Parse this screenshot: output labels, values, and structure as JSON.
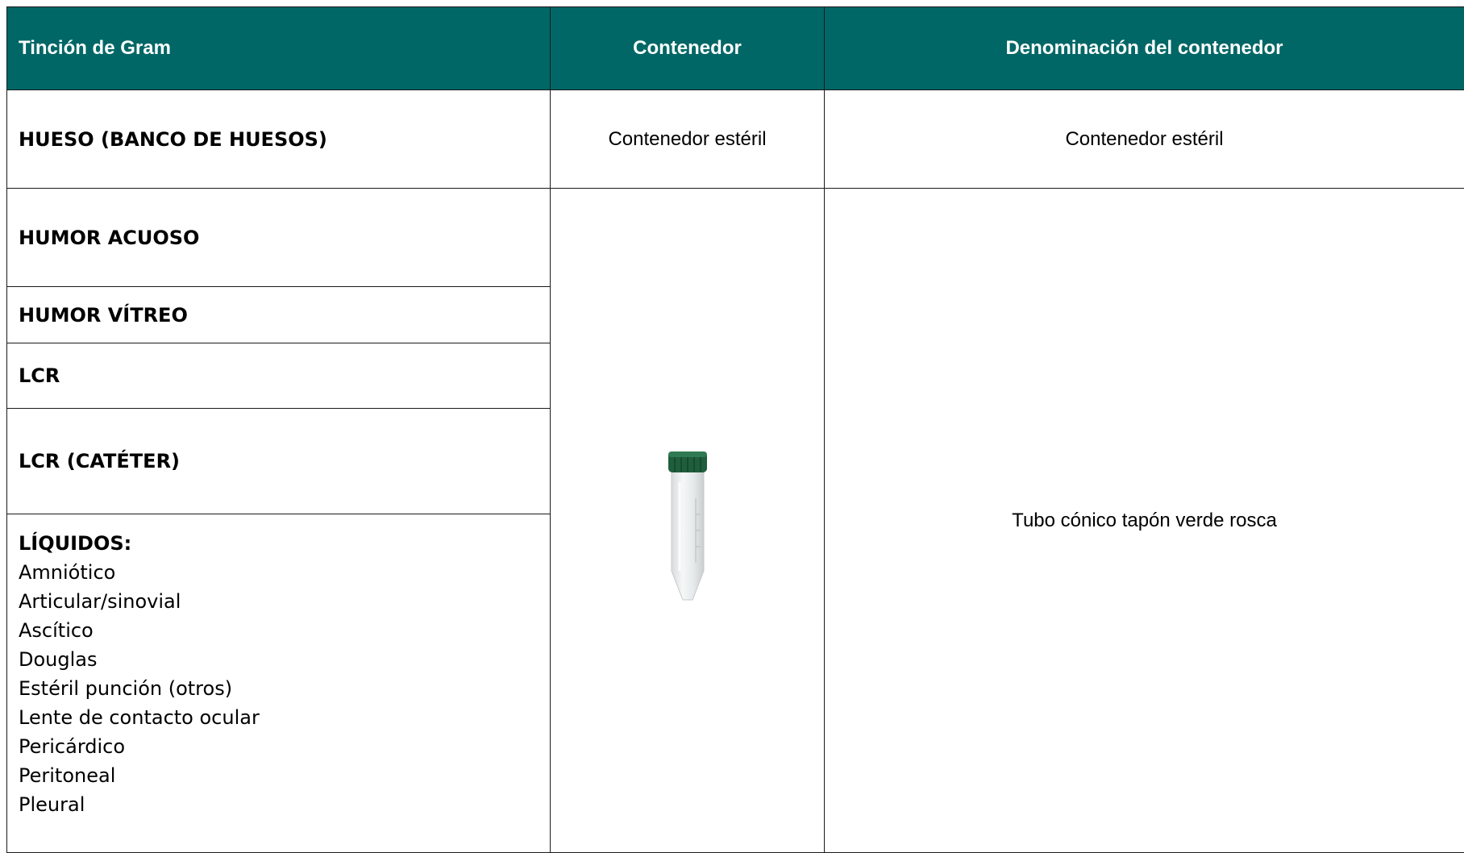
{
  "header": {
    "col1": "Tinción de Gram",
    "col2": "Contenedor",
    "col3": "Denominación del contenedor"
  },
  "rows": [
    {
      "sample": "HUESO (BANCO DE HUESOS)",
      "container": "Contenedor estéril",
      "container_name": "Contenedor estéril"
    }
  ],
  "group": {
    "samples": [
      "HUMOR ACUOSO",
      "HUMOR VÍTREO",
      "LCR",
      "LCR (CATÉTER)"
    ],
    "liquids": {
      "heading": "LÍQUIDOS:",
      "items": [
        "Amniótico",
        "Articular/sinovial",
        "Ascítico",
        "Douglas",
        "Estéril punción (otros)",
        "Lente de contacto ocular",
        "Pericárdico",
        "Peritoneal",
        "Pleural"
      ]
    },
    "container_icon": "conical-tube-green-cap-icon",
    "container_name": "Tubo cónico tapón verde rosca"
  },
  "colors": {
    "header_bg": "#006766",
    "header_text": "#ffffff",
    "tube_cap": "#1f5e3c"
  }
}
